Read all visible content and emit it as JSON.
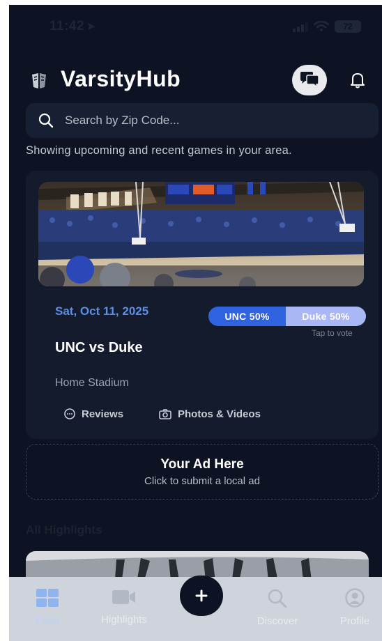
{
  "status_bar": {
    "time": "11:42",
    "battery": "72"
  },
  "header": {
    "app_title": "VarsityHub"
  },
  "search": {
    "placeholder": "Search by Zip Code..."
  },
  "subtitle": "Showing upcoming and recent games in your area.",
  "game": {
    "date": "Sat, Oct 11, 2025",
    "matchup": "UNC vs Duke",
    "venue": "Home Stadium",
    "vote": {
      "unc_label": "UNC 50%",
      "duke_label": "Duke 50%",
      "unc_share": 0.5,
      "hint": "Tap to vote"
    },
    "actions": {
      "reviews": "Reviews",
      "photos": "Photos & Videos"
    },
    "colors": {
      "unc": "#2f63e0",
      "duke": "#a9b7f5",
      "date": "#5b8ee6"
    }
  },
  "ad": {
    "title": "Your Ad Here",
    "subtitle": "Click to submit a local ad"
  },
  "highlights": {
    "section_title": "All Highlights"
  },
  "tabbar": {
    "items": [
      {
        "label": "Feed",
        "icon": "grid-icon",
        "active": true
      },
      {
        "label": "Highlights",
        "icon": "video-camera-icon",
        "active": false
      },
      {
        "label": "Discover",
        "icon": "search-icon",
        "active": false
      },
      {
        "label": "Profile",
        "icon": "user-circle-icon",
        "active": false
      }
    ],
    "fab_icon": "plus-icon"
  }
}
